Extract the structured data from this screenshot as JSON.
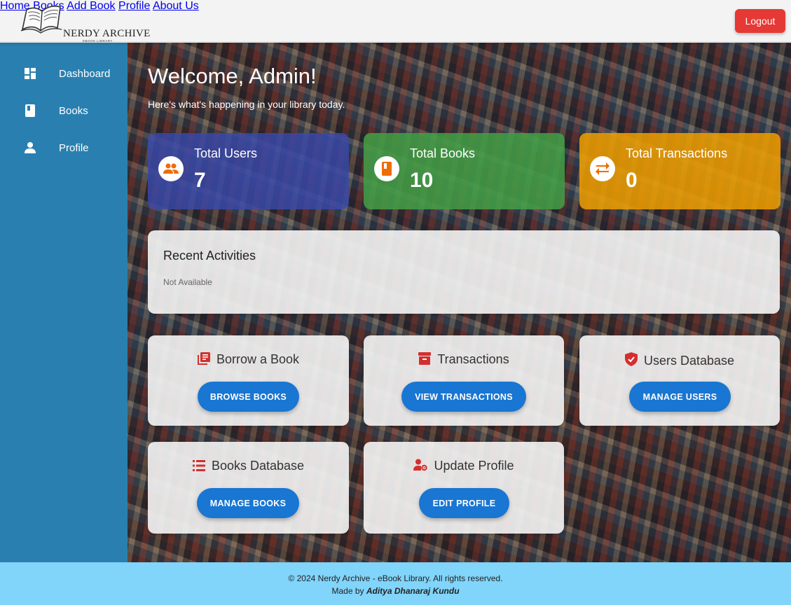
{
  "brand": {
    "title": "NERDY ARCHIVE",
    "subtitle": "EBOOK LIBRARY"
  },
  "nav": {
    "home": "Home",
    "books": "Books",
    "add_book": "Add Book",
    "profile": "Profile",
    "about": "About Us",
    "logout": "Logout"
  },
  "sidebar": {
    "items": [
      {
        "label": "Dashboard",
        "icon": "dashboard-icon"
      },
      {
        "label": "Books",
        "icon": "book-icon"
      },
      {
        "label": "Profile",
        "icon": "person-icon"
      }
    ]
  },
  "welcome": {
    "title": "Welcome, Admin!",
    "subtitle": "Here's what's happening in your library today."
  },
  "stats": [
    {
      "title": "Total Users",
      "value": "7",
      "icon": "users-icon",
      "color": "#3949ab"
    },
    {
      "title": "Total Books",
      "value": "10",
      "icon": "book-icon",
      "color": "#43a047"
    },
    {
      "title": "Total Transactions",
      "value": "0",
      "icon": "swap-icon",
      "color": "#f0a000"
    }
  ],
  "recent": {
    "title": "Recent Activities",
    "value": "Not Available"
  },
  "actions": [
    {
      "title": "Borrow a Book",
      "button": "BROWSE BOOKS",
      "icon": "library-books-icon"
    },
    {
      "title": "Transactions",
      "button": "VIEW TRANSACTIONS",
      "icon": "archive-icon"
    },
    {
      "title": "Users Database",
      "button": "MANAGE USERS",
      "icon": "shield-icon"
    },
    {
      "title": "Books Database",
      "button": "MANAGE BOOKS",
      "icon": "list-icon"
    },
    {
      "title": "Update Profile",
      "button": "EDIT PROFILE",
      "icon": "manage-account-icon"
    }
  ],
  "footer": {
    "line1": "© 2024 Nerdy Archive - eBook Library. All rights reserved.",
    "made_by": "Made by",
    "author": "Aditya Dhanaraj Kundu"
  },
  "colors": {
    "sidebar": "#2980b0",
    "accent": "#1976d2",
    "logout": "#e53935",
    "footer": "#81d4fa",
    "icon_red": "#d32f2f"
  }
}
